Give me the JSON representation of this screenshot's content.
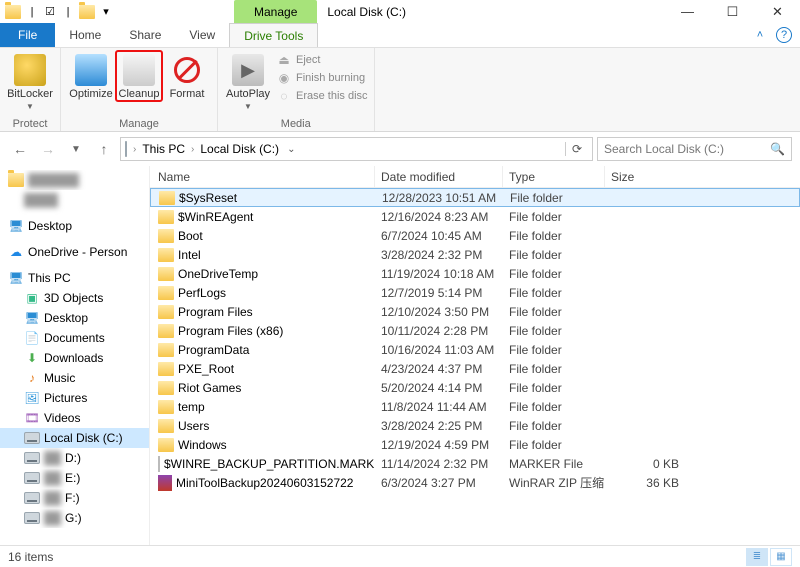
{
  "window": {
    "title": "Local Disk (C:)",
    "manage_tab": "Manage",
    "min": "—",
    "max": "☐",
    "close": "✕"
  },
  "tabs": {
    "file": "File",
    "home": "Home",
    "share": "Share",
    "view": "View",
    "drive_tools": "Drive Tools"
  },
  "ribbon": {
    "groups": {
      "protect": {
        "label": "Protect",
        "bitlocker": "BitLocker"
      },
      "manage": {
        "label": "Manage",
        "optimize": "Optimize",
        "cleanup": "Cleanup",
        "format": "Format"
      },
      "media": {
        "label": "Media",
        "autoplay": "AutoPlay",
        "eject": "Eject",
        "finish": "Finish burning",
        "erase": "Erase this disc"
      }
    }
  },
  "address": {
    "root": "This PC",
    "leaf": "Local Disk (C:)",
    "search_placeholder": "Search Local Disk (C:)"
  },
  "tree": {
    "desktop": "Desktop",
    "onedrive": "OneDrive - Person",
    "thispc": "This PC",
    "threed": "3D Objects",
    "desktop2": "Desktop",
    "documents": "Documents",
    "downloads": "Downloads",
    "music": "Music",
    "pictures": "Pictures",
    "videos": "Videos",
    "cdrive": "Local Disk (C:)",
    "d": "D:)",
    "e": "E:)",
    "f": "F:)",
    "g": "G:)"
  },
  "columns": {
    "name": "Name",
    "date": "Date modified",
    "type": "Type",
    "size": "Size"
  },
  "rows": [
    {
      "name": "$SysReset",
      "date": "12/28/2023 10:51 AM",
      "type": "File folder",
      "size": "",
      "icon": "folder",
      "sel": true
    },
    {
      "name": "$WinREAgent",
      "date": "12/16/2024 8:23 AM",
      "type": "File folder",
      "size": "",
      "icon": "folder"
    },
    {
      "name": "Boot",
      "date": "6/7/2024 10:45 AM",
      "type": "File folder",
      "size": "",
      "icon": "folder"
    },
    {
      "name": "Intel",
      "date": "3/28/2024 2:32 PM",
      "type": "File folder",
      "size": "",
      "icon": "folder"
    },
    {
      "name": "OneDriveTemp",
      "date": "11/19/2024 10:18 AM",
      "type": "File folder",
      "size": "",
      "icon": "folder"
    },
    {
      "name": "PerfLogs",
      "date": "12/7/2019 5:14 PM",
      "type": "File folder",
      "size": "",
      "icon": "folder"
    },
    {
      "name": "Program Files",
      "date": "12/10/2024 3:50 PM",
      "type": "File folder",
      "size": "",
      "icon": "folder"
    },
    {
      "name": "Program Files (x86)",
      "date": "10/11/2024 2:28 PM",
      "type": "File folder",
      "size": "",
      "icon": "folder"
    },
    {
      "name": "ProgramData",
      "date": "10/16/2024 11:03 AM",
      "type": "File folder",
      "size": "",
      "icon": "folder"
    },
    {
      "name": "PXE_Root",
      "date": "4/23/2024 4:37 PM",
      "type": "File folder",
      "size": "",
      "icon": "folder"
    },
    {
      "name": "Riot Games",
      "date": "5/20/2024 4:14 PM",
      "type": "File folder",
      "size": "",
      "icon": "folder"
    },
    {
      "name": "temp",
      "date": "11/8/2024 11:44 AM",
      "type": "File folder",
      "size": "",
      "icon": "folder"
    },
    {
      "name": "Users",
      "date": "3/28/2024 2:25 PM",
      "type": "File folder",
      "size": "",
      "icon": "folder"
    },
    {
      "name": "Windows",
      "date": "12/19/2024 4:59 PM",
      "type": "File folder",
      "size": "",
      "icon": "folder"
    },
    {
      "name": "$WINRE_BACKUP_PARTITION.MARKER",
      "date": "11/14/2024 2:32 PM",
      "type": "MARKER File",
      "size": "0 KB",
      "icon": "file"
    },
    {
      "name": "MiniToolBackup20240603152722",
      "date": "6/3/2024 3:27 PM",
      "type": "WinRAR ZIP 压缩…",
      "size": "36 KB",
      "icon": "rar"
    }
  ],
  "status": {
    "count": "16 items"
  }
}
